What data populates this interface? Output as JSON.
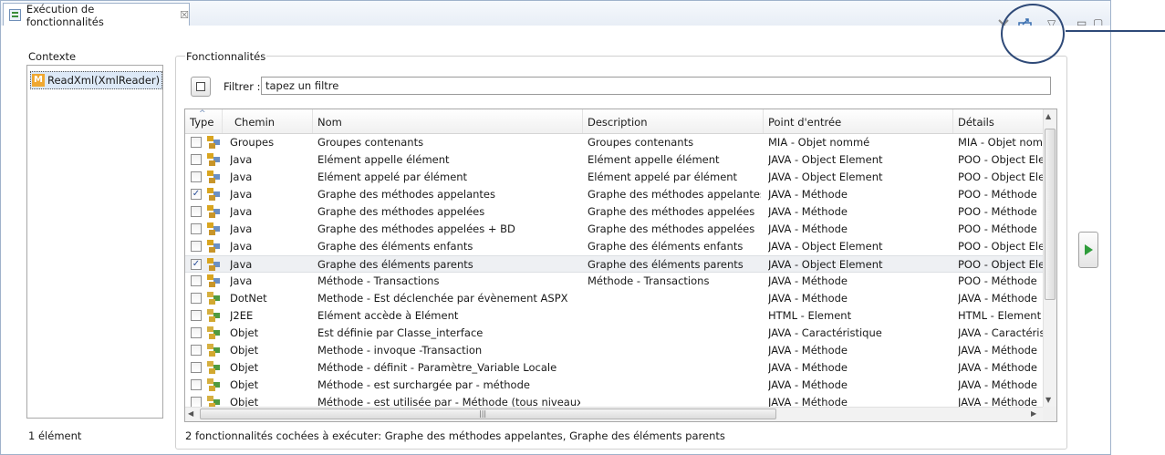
{
  "tab": {
    "title": "Exécution de fonctionnalités",
    "close_glyph": "☒"
  },
  "contexte": {
    "label": "Contexte",
    "item_icon_letter": "M",
    "item": "ReadXml(XmlReader)",
    "count": "1 élément"
  },
  "fonctionnalites": {
    "label": "Fonctionnalités",
    "filter_label": "Filtrer :",
    "filter_value": "tapez un filtre",
    "columns": [
      "Type",
      "Chemin",
      "Nom",
      "Description",
      "Point d'entrée",
      "Détails"
    ],
    "rows": [
      {
        "checked": false,
        "chemin": "Groupes",
        "nom": "Groupes contenants",
        "description": "Groupes contenants",
        "point": "MIA - Objet nommé",
        "details": "MIA - Objet nommé",
        "icon": "group-icon"
      },
      {
        "checked": false,
        "chemin": "Java",
        "nom": "Elément appelle élément",
        "description": "Elément appelle élément",
        "point": "JAVA - Object Element",
        "details": "POO - Object Element",
        "icon": "group-icon"
      },
      {
        "checked": false,
        "chemin": "Java",
        "nom": "Elément appelé par élément",
        "description": "Elément appelé par élément",
        "point": "JAVA - Object Element",
        "details": "POO - Object Element",
        "icon": "group-icon"
      },
      {
        "checked": true,
        "chemin": "Java",
        "nom": "Graphe des méthodes appelantes",
        "description": "Graphe des méthodes appelantes",
        "point": "JAVA - Méthode",
        "details": "POO - Méthode",
        "icon": "group-icon"
      },
      {
        "checked": false,
        "chemin": "Java",
        "nom": "Graphe des méthodes appelées",
        "description": "Graphe des méthodes appelées",
        "point": "JAVA - Méthode",
        "details": "POO - Méthode",
        "icon": "group-icon"
      },
      {
        "checked": false,
        "chemin": "Java",
        "nom": "Graphe des méthodes appelées + BD",
        "description": "Graphe des méthodes appelées",
        "point": "JAVA - Méthode",
        "details": "POO - Méthode",
        "icon": "group-icon"
      },
      {
        "checked": false,
        "chemin": "Java",
        "nom": "Graphe des éléments enfants",
        "description": "Graphe des éléments enfants",
        "point": "JAVA - Object Element",
        "details": "POO - Object Element",
        "icon": "group-icon"
      },
      {
        "checked": true,
        "chemin": "Java",
        "nom": "Graphe des éléments parents",
        "description": "Graphe des éléments parents",
        "point": "JAVA - Object Element",
        "details": "POO - Object Element",
        "icon": "group-icon",
        "selected": true
      },
      {
        "checked": false,
        "chemin": "Java",
        "nom": "Méthode - Transactions",
        "description": "Méthode - Transactions",
        "point": "JAVA - Méthode",
        "details": "POO - Méthode",
        "icon": "group-icon"
      },
      {
        "checked": false,
        "chemin": "DotNet",
        "nom": "Methode  - Est déclenchée par évènement ASPX",
        "description": "",
        "point": "JAVA - Méthode",
        "details": "JAVA - Méthode",
        "icon": "query-icon"
      },
      {
        "checked": false,
        "chemin": "J2EE",
        "nom": "Elément accède à Elément",
        "description": "",
        "point": "HTML - Element",
        "details": "HTML - Element",
        "icon": "query-icon"
      },
      {
        "checked": false,
        "chemin": "Objet",
        "nom": "Est définie par Classe_interface",
        "description": "",
        "point": "JAVA - Caractéristique",
        "details": "JAVA - Caractéristique",
        "icon": "query-icon"
      },
      {
        "checked": false,
        "chemin": "Objet",
        "nom": "Methode - invoque -Transaction",
        "description": "",
        "point": "JAVA - Méthode",
        "details": "JAVA - Méthode",
        "icon": "query-icon"
      },
      {
        "checked": false,
        "chemin": "Objet",
        "nom": "Méthode - définit - Paramètre_Variable Locale",
        "description": "",
        "point": "JAVA - Méthode",
        "details": "JAVA - Méthode",
        "icon": "query-icon"
      },
      {
        "checked": false,
        "chemin": "Objet",
        "nom": "Méthode - est surchargée par - méthode",
        "description": "",
        "point": "JAVA - Méthode",
        "details": "JAVA - Méthode",
        "icon": "query-icon"
      },
      {
        "checked": false,
        "chemin": "Objet",
        "nom": "Méthode - est utilisée par - Méthode (tous niveaux)",
        "description": "",
        "point": "JAVA - Méthode",
        "details": "JAVA - Méthode",
        "icon": "query-icon"
      }
    ],
    "status": "2 fonctionnalités cochées à exécuter: Graphe des méthodes appelantes, Graphe des éléments parents"
  },
  "icons": {
    "clear": "clear-icon",
    "export": "export-icon",
    "menu": "view-menu-icon",
    "minimize": "minimize-icon",
    "maximize": "maximize-icon",
    "run": "run-icon",
    "sort": "sort-up-icon"
  },
  "glyphs": {
    "sort": "^",
    "up": "▲",
    "down": "▼",
    "left": "◀",
    "right": "▶",
    "grip": "|||",
    "menu": "▽",
    "min": "▭",
    "max": "▢",
    "check": "✓"
  },
  "colors": {
    "accent": "#2f4a78",
    "run": "#2e9c3a",
    "selected_row": "#eef0f3"
  }
}
